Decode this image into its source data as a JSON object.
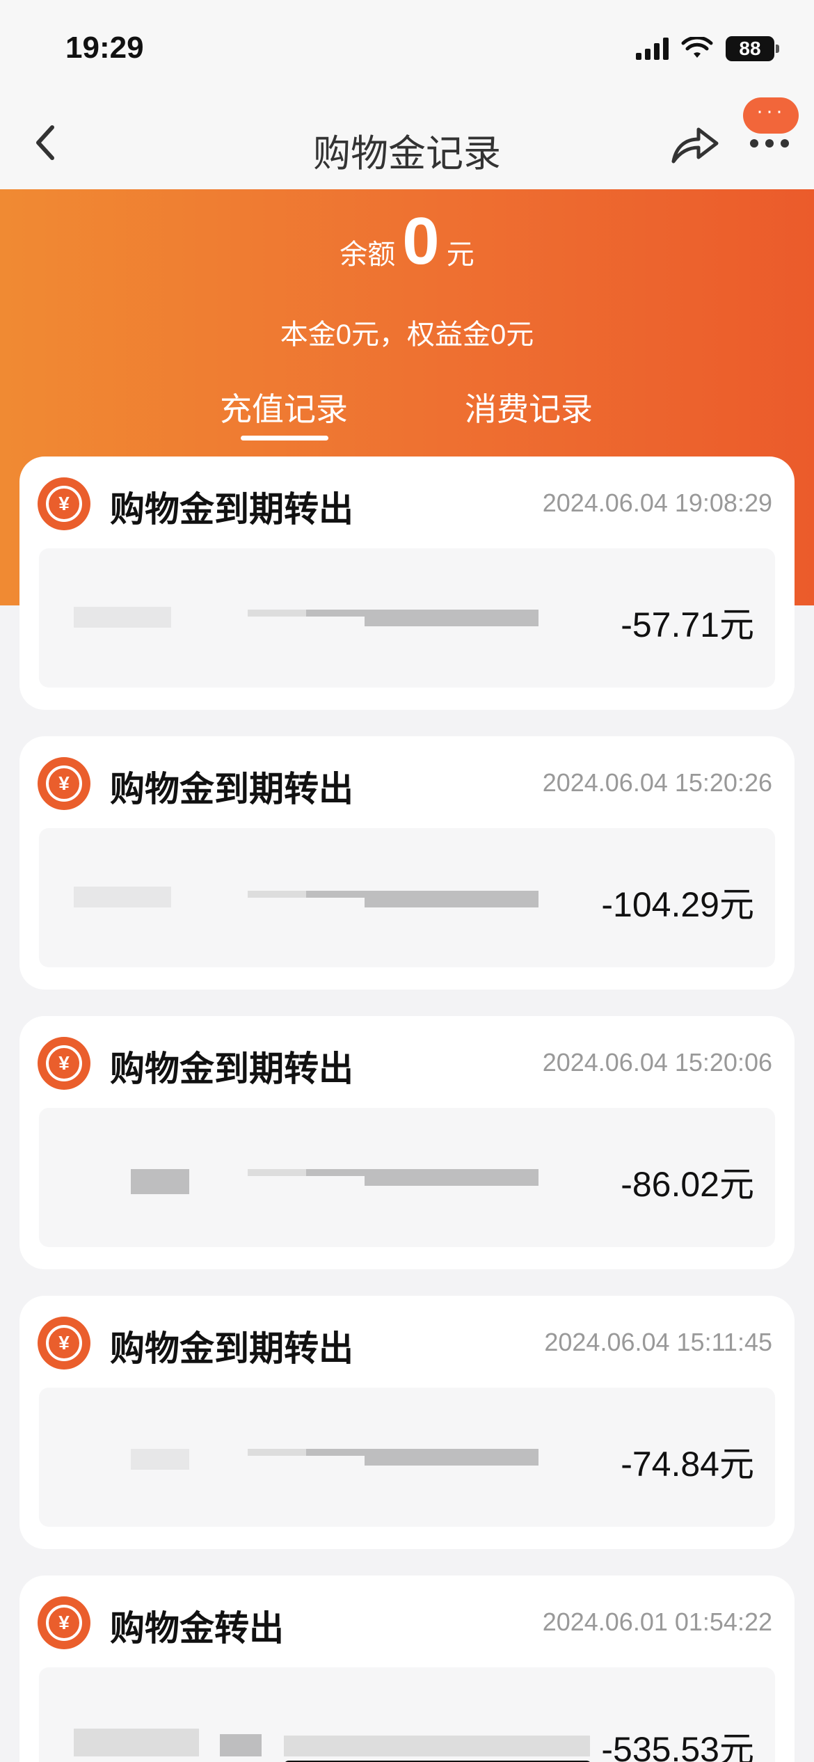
{
  "status_bar": {
    "time": "19:29",
    "battery": "88"
  },
  "nav": {
    "title": "购物金记录",
    "more_label": "···"
  },
  "header": {
    "balance_label": "余额",
    "balance_value": "0",
    "balance_unit": "元",
    "breakdown": "本金0元，权益金0元",
    "tabs": [
      {
        "label": "充值记录",
        "active": true
      },
      {
        "label": "消费记录",
        "active": false
      }
    ]
  },
  "records": [
    {
      "title": "购物金到期转出",
      "time": "2024.06.04 19:08:29",
      "amount": "-57.71元"
    },
    {
      "title": "购物金到期转出",
      "time": "2024.06.04 15:20:26",
      "amount": "-104.29元"
    },
    {
      "title": "购物金到期转出",
      "time": "2024.06.04 15:20:06",
      "amount": "-86.02元"
    },
    {
      "title": "购物金到期转出",
      "time": "2024.06.04 15:11:45",
      "amount": "-74.84元"
    },
    {
      "title": "购物金转出",
      "time": "2024.06.01 01:54:22",
      "amount": "-535.53元"
    }
  ],
  "icon_glyph": "¥",
  "colors": {
    "accent": "#ea5e2c",
    "header_start": "#f08a33",
    "header_end": "#eb5b2b"
  }
}
